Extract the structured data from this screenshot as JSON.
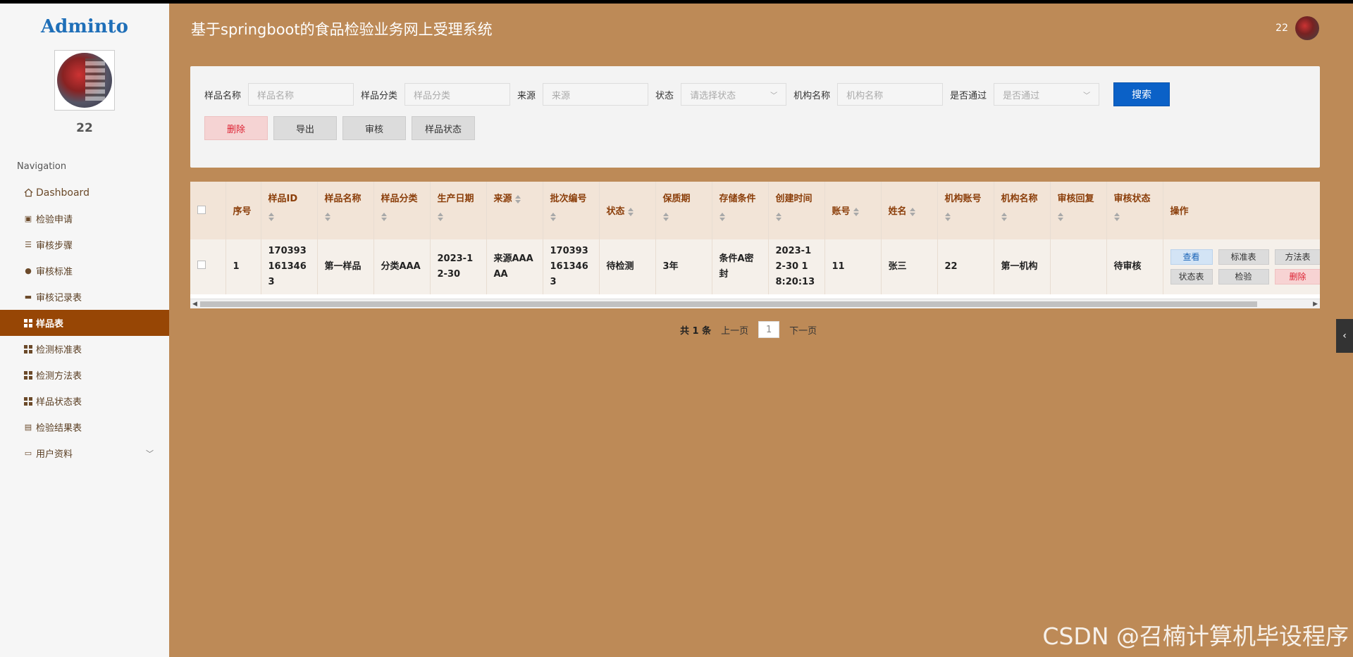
{
  "app": {
    "title": "基于springboot的食品检验业务网上受理系统"
  },
  "sidebar": {
    "logo": "Adminto",
    "user_name": "22",
    "nav_title": "Navigation",
    "items": [
      {
        "label": "Dashboard",
        "icon": "home-icon"
      },
      {
        "label": "检验申请",
        "icon": "clipboard-icon"
      },
      {
        "label": "审核步骤",
        "icon": "list-icon"
      },
      {
        "label": "审核标准",
        "icon": "user-icon"
      },
      {
        "label": "审核记录表",
        "icon": "monitor-icon"
      },
      {
        "label": "样品表",
        "icon": "grid-icon",
        "active": true
      },
      {
        "label": "检测标准表",
        "icon": "grid-icon"
      },
      {
        "label": "检测方法表",
        "icon": "grid-icon"
      },
      {
        "label": "样品状态表",
        "icon": "grid-icon"
      },
      {
        "label": "检验结果表",
        "icon": "printer-icon"
      },
      {
        "label": "用户资料",
        "icon": "form-icon",
        "expandable": true
      }
    ]
  },
  "header": {
    "user_name": "22"
  },
  "search": {
    "fields": [
      {
        "label": "样品名称",
        "placeholder": "样品名称"
      },
      {
        "label": "样品分类",
        "placeholder": "样品分类"
      },
      {
        "label": "来源",
        "placeholder": "来源"
      },
      {
        "label": "状态",
        "placeholder": "请选择状态"
      },
      {
        "label": "机构名称",
        "placeholder": "机构名称"
      },
      {
        "label": "是否通过",
        "placeholder": "是否通过"
      }
    ],
    "search_button": "搜索"
  },
  "actions": {
    "delete": "删除",
    "export": "导出",
    "audit": "审核",
    "sample_status": "样品状态"
  },
  "table": {
    "columns": [
      "序号",
      "样品ID",
      "样品名称",
      "样品分类",
      "生产日期",
      "来源",
      "批次编号",
      "状态",
      "保质期",
      "存储条件",
      "创建时间",
      "账号",
      "姓名",
      "机构账号",
      "机构名称",
      "审核回复",
      "审核状态",
      "操作"
    ],
    "row": {
      "index": "1",
      "sample_id": "1703931613463",
      "sample_name": "第一样品",
      "category": "分类AAA",
      "production_date": "2023-12-30",
      "source": "来源AAAAA",
      "batch_no": "1703931613463",
      "status": "待检测",
      "shelf_life": "3年",
      "storage": "条件A密封",
      "created_at": "2023-12-30 18:20:13",
      "account": "11",
      "name": "张三",
      "org_account": "22",
      "org_name": "第一机构",
      "audit_reply": "",
      "audit_status": "待审核"
    },
    "row_ops": {
      "view": "查看",
      "standard": "标准表",
      "method": "方法表",
      "status": "状态表",
      "inspect": "检验",
      "delete": "删除"
    }
  },
  "pagination": {
    "total": "共 1 条",
    "prev": "上一页",
    "page": "1",
    "next": "下一页"
  },
  "watermark": "CSDN @召楠计算机毕设程序",
  "colors": {
    "background": "#bd8a57",
    "active_nav": "#974605",
    "primary": "#0b61c7"
  }
}
